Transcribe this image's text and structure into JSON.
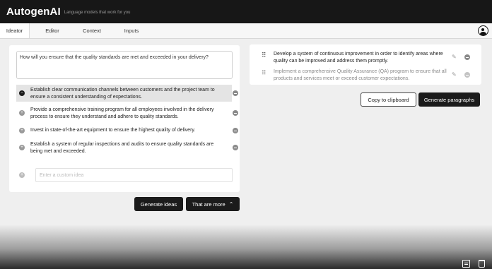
{
  "app": {
    "name": "AutogenAI",
    "tagline": "Language models that work for you"
  },
  "tabs": [
    {
      "label": "Ideator",
      "active": true
    },
    {
      "label": "Editor",
      "active": false
    },
    {
      "label": "Context",
      "active": false
    },
    {
      "label": "Inputs",
      "active": false
    }
  ],
  "ideator": {
    "question": "How will you ensure that the quality standards are met and exceeded in your delivery?",
    "ideas": [
      {
        "text": "Establish clear communication channels between customers and the project team to ensure a consistent understanding of expectations.",
        "selected": true
      },
      {
        "text": "Provide a comprehensive training program for all employees involved in the delivery process to ensure they understand and adhere to quality standards.",
        "selected": false
      },
      {
        "text": "Invest in state-of-the-art equipment to ensure the highest quality of delivery.",
        "selected": false
      },
      {
        "text": "Establish a system of regular inspections and audits to ensure quality standards are being met and exceeded.",
        "selected": false
      }
    ],
    "custom_placeholder": "Enter a custom idea",
    "generate_ideas_label": "Generate ideas",
    "more_label": "That are more"
  },
  "paragraphs": {
    "items": [
      {
        "text": "Develop a system of continuous improvement in order to identify areas where quality can be improved and address them promptly.",
        "muted": false
      },
      {
        "text": "Implement a comprehensive Quality Assurance (QA) program to ensure that all products and services meet or exceed customer expectations.",
        "muted": true
      }
    ],
    "copy_label": "Copy to clipboard",
    "generate_label": "Generate paragraphs"
  },
  "icons": {
    "user": "user-circle-icon",
    "drag": "drag-handle-icon",
    "edit": "pencil-icon",
    "remove": "minus-circle-icon",
    "add": "plus-circle-icon"
  }
}
